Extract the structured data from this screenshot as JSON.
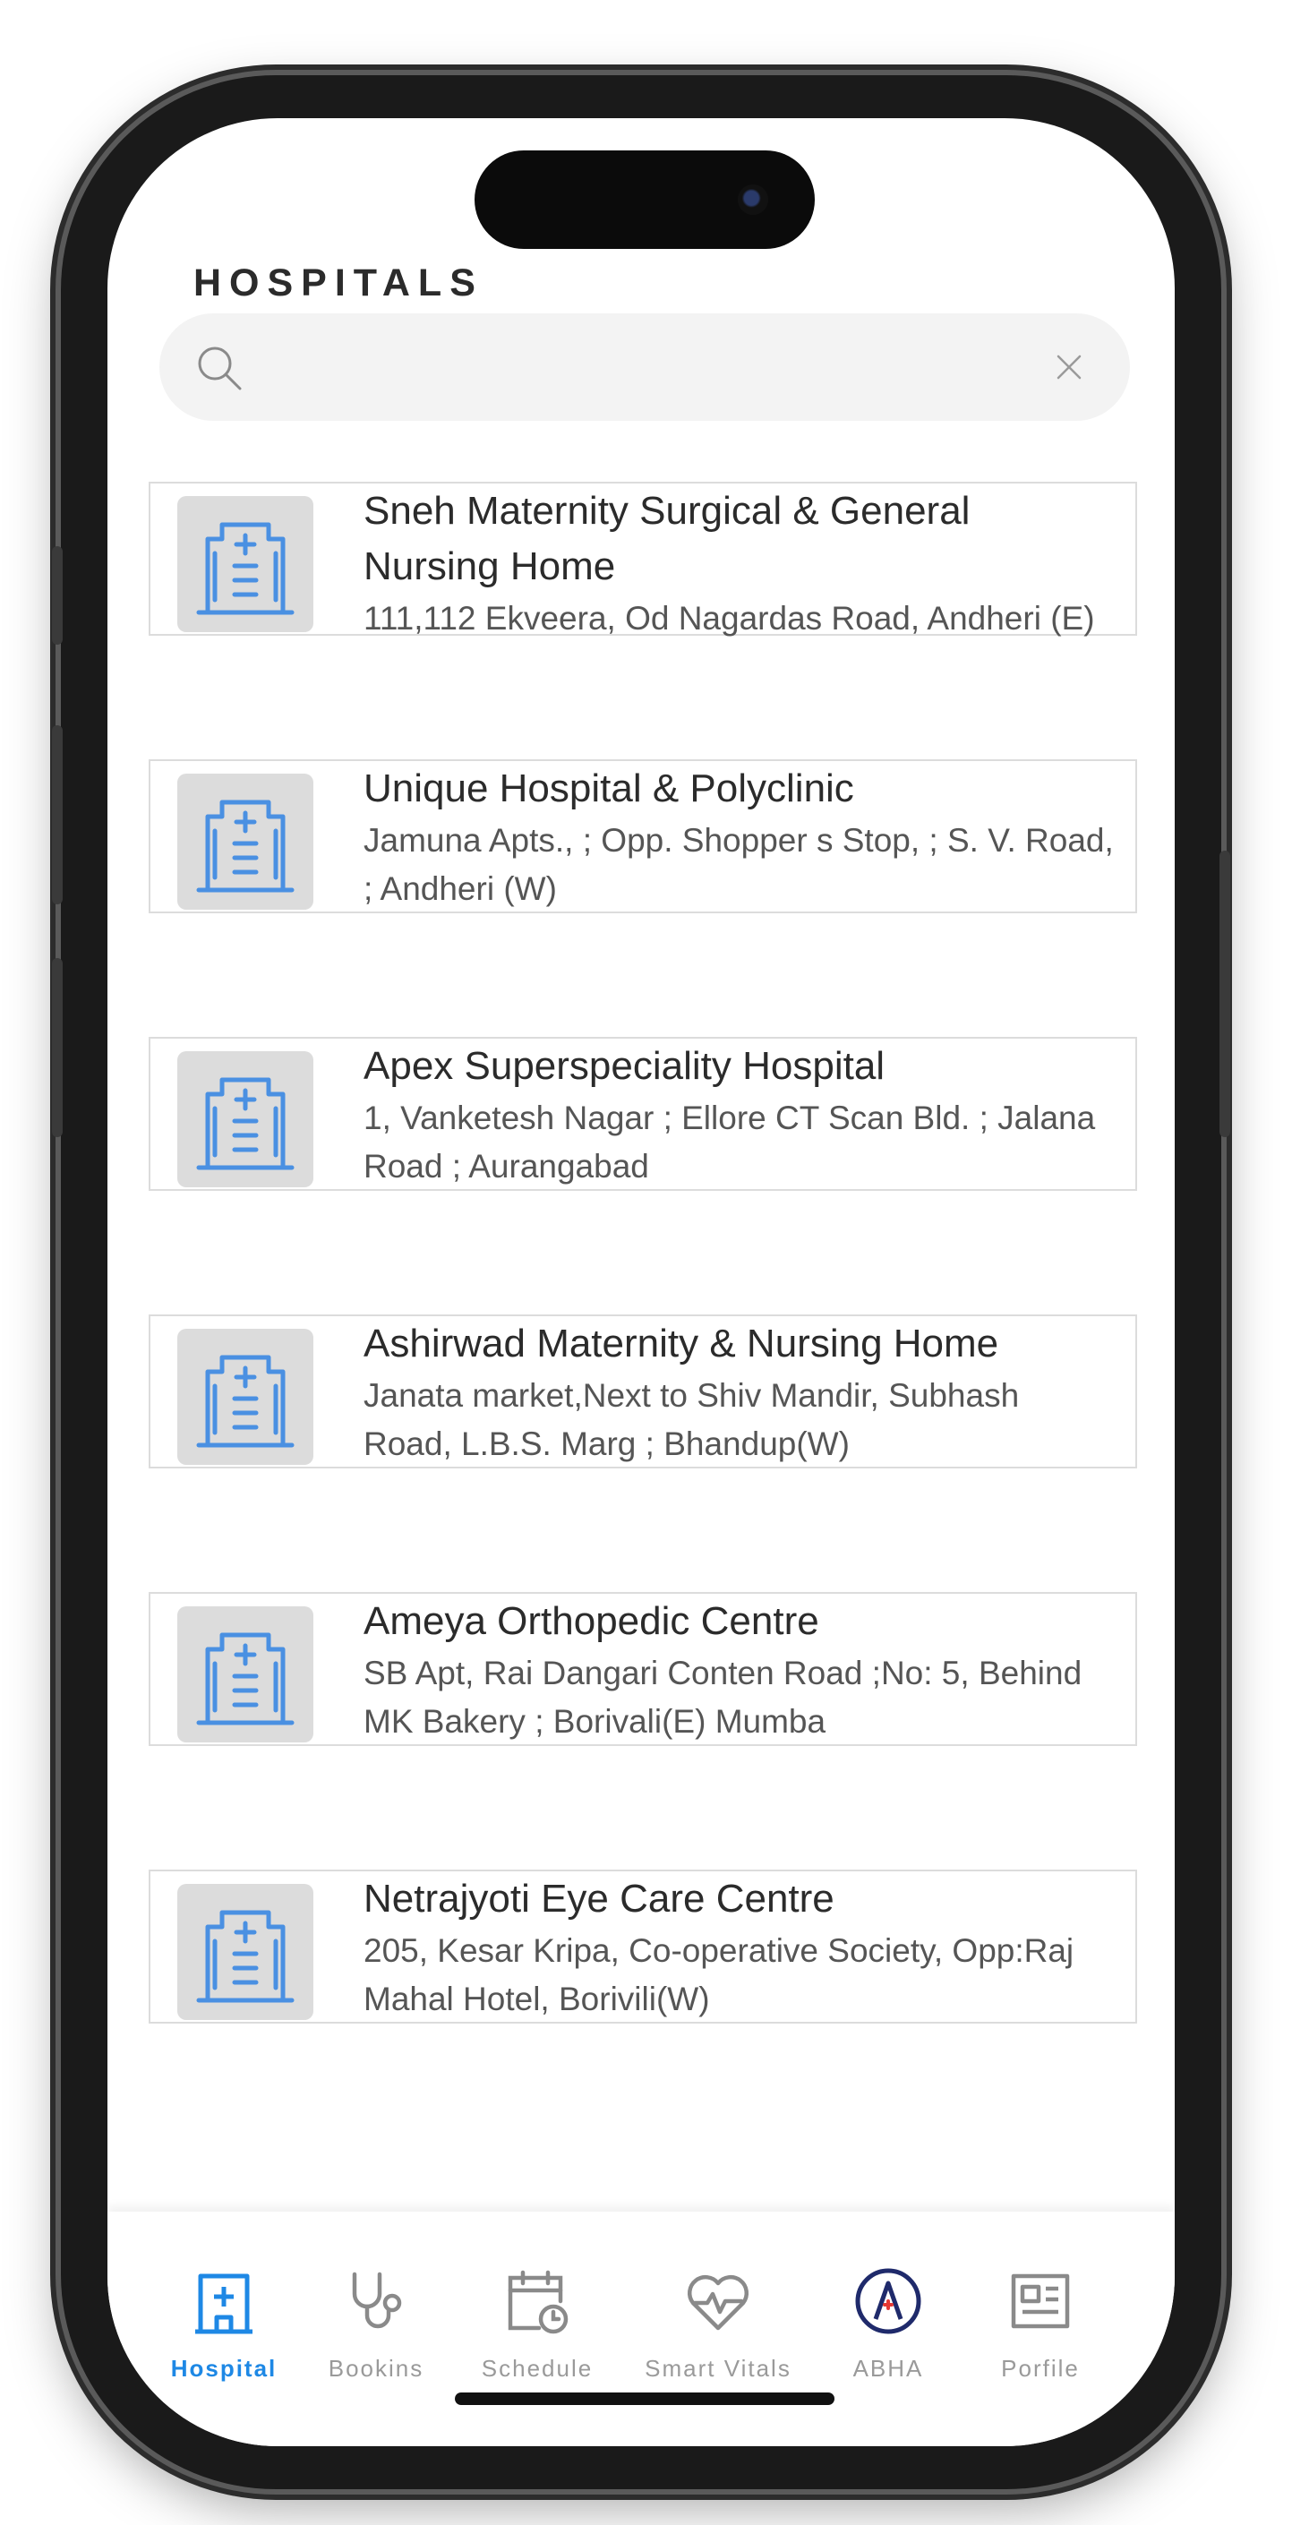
{
  "page": {
    "title": "HOSPITALS"
  },
  "search": {
    "placeholder": "",
    "value": ""
  },
  "hospitals": [
    {
      "name": "Sneh Maternity Surgical & General Nursing Home",
      "address": "111,112 Ekveera, Od Nagardas Road, Andheri (E)"
    },
    {
      "name": "Unique Hospital & Polyclinic",
      "address": "Jamuna Apts., ; Opp. Shopper s Stop, ; S. V. Road, ; Andheri (W)"
    },
    {
      "name": "Apex Superspeciality Hospital",
      "address": "1, Vanketesh Nagar ; Ellore CT Scan Bld. ; Jalana Road ; Aurangabad"
    },
    {
      "name": "Ashirwad Maternity & Nursing Home",
      "address": "Janata market,Next to Shiv Mandir, Subhash Road, L.B.S. Marg ; Bhandup(W)"
    },
    {
      "name": "Ameya Orthopedic Centre",
      "address": "SB Apt, Rai Dangari Conten Road ;No: 5, Behind MK Bakery ; Borivali(E)  Mumba"
    },
    {
      "name": "Netrajyoti Eye Care Centre",
      "address": "205, Kesar Kripa, Co-operative Society, Opp:Raj Mahal Hotel, Borivili(W)"
    }
  ],
  "tabs": {
    "hospital": "Hospital",
    "bookings": "Bookins",
    "schedule": "Schedule",
    "smart_vitals": "Smart Vitals",
    "abha": "ABHA",
    "profile": "Porfile"
  },
  "colors": {
    "accent": "#1e88e5",
    "icon_blue": "#4a90e2",
    "inactive": "#9a9a9a"
  }
}
